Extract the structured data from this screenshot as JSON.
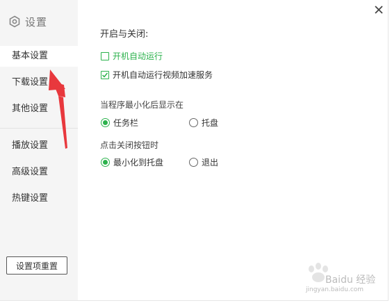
{
  "app": {
    "title": "设置"
  },
  "sidebar": {
    "items": [
      {
        "label": "基本设置",
        "active": true
      },
      {
        "label": "下载设置"
      },
      {
        "label": "其他设置"
      },
      {
        "label": "播放设置"
      },
      {
        "label": "高级设置"
      },
      {
        "label": "热键设置"
      }
    ],
    "reset_label": "设置项重置"
  },
  "main": {
    "startup": {
      "title": "开启与关闭:",
      "options": [
        {
          "label": "开机自动运行",
          "checked": false
        },
        {
          "label": "开机自动运行视频加速服务",
          "checked": true
        }
      ]
    },
    "minimize": {
      "title": "当程序最小化后显示在",
      "options": [
        {
          "label": "任务栏",
          "selected": true
        },
        {
          "label": "托盘",
          "selected": false
        }
      ]
    },
    "close_action": {
      "title": "点击关闭按钮时",
      "options": [
        {
          "label": "最小化到托盘",
          "selected": true
        },
        {
          "label": "退出",
          "selected": false
        }
      ]
    }
  },
  "watermark": {
    "text": "Baidu 经验",
    "url": "jingyan.baidu.com"
  },
  "colors": {
    "accent": "#2bb24c",
    "annotation_arrow": "#e8383d",
    "sidebar_bg": "#f5f5f5"
  },
  "icons": {
    "brand": "hexagon-gear-icon",
    "close": "close-icon",
    "checked": "check-icon"
  }
}
